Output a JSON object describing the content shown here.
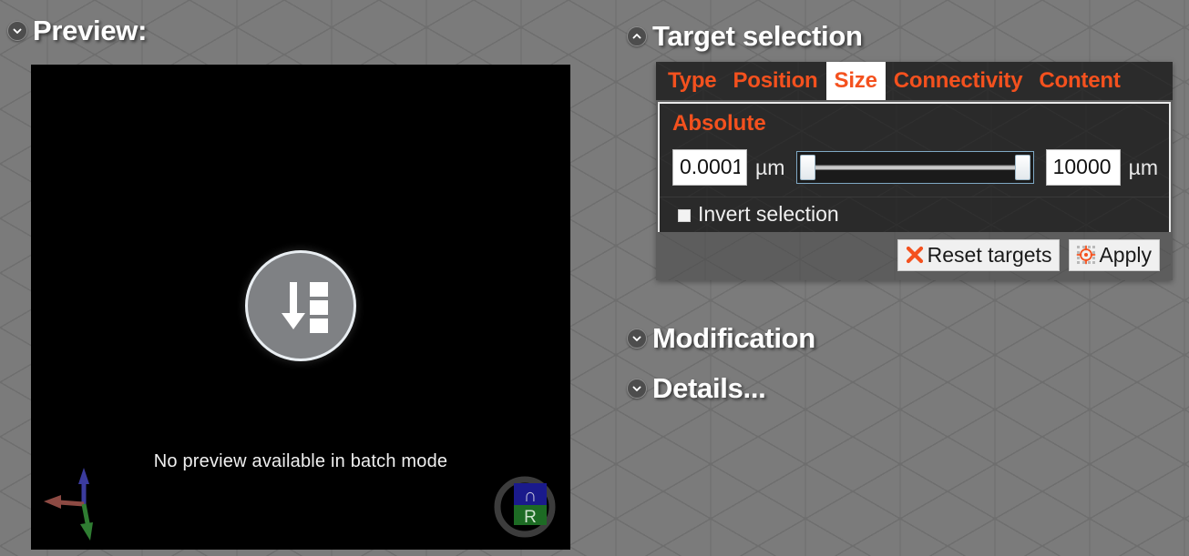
{
  "preview": {
    "header": {
      "title": "Preview:",
      "twisty_icon": "chevron-down-icon",
      "expanded": true
    },
    "busy_icon": "batch-sort-down-icon",
    "message": "No preview available in batch mode",
    "axis_gizmo_icon": "axis-triad-icon",
    "nav_cube": {
      "icon": "navigation-cube-icon",
      "top_face_label": "∩",
      "front_face_label": "R"
    }
  },
  "target_selection": {
    "header": {
      "title": "Target selection",
      "twisty_icon": "chevron-up-icon",
      "expanded": true
    },
    "tabs": [
      {
        "label": "Type",
        "active": false
      },
      {
        "label": "Position",
        "active": false
      },
      {
        "label": "Size",
        "active": true
      },
      {
        "label": "Connectivity",
        "active": false
      },
      {
        "label": "Content",
        "active": false
      }
    ],
    "group_title": "Absolute",
    "range": {
      "min_value": "0.0001",
      "min_unit": "µm",
      "max_value": "10000",
      "max_unit": "µm",
      "slider_low_pct": 0,
      "slider_high_pct": 100
    },
    "invert": {
      "label": "Invert selection",
      "checked": false
    },
    "buttons": [
      {
        "label": "Reset targets",
        "icon": "red-x-icon"
      },
      {
        "label": "Apply",
        "icon": "crosshair-target-icon"
      }
    ]
  },
  "modification": {
    "header": {
      "title": "Modification",
      "twisty_icon": "chevron-down-icon",
      "expanded": false
    }
  },
  "details": {
    "header": {
      "title": "Details...",
      "twisty_icon": "chevron-down-icon",
      "expanded": false
    }
  },
  "colors": {
    "accent_orange": "#f4511e",
    "background_gray": "#7b7b7b",
    "panel_dark": "#2a2a2a",
    "viewport_black": "#000000",
    "slider_border_blue": "#7fa8c4"
  }
}
